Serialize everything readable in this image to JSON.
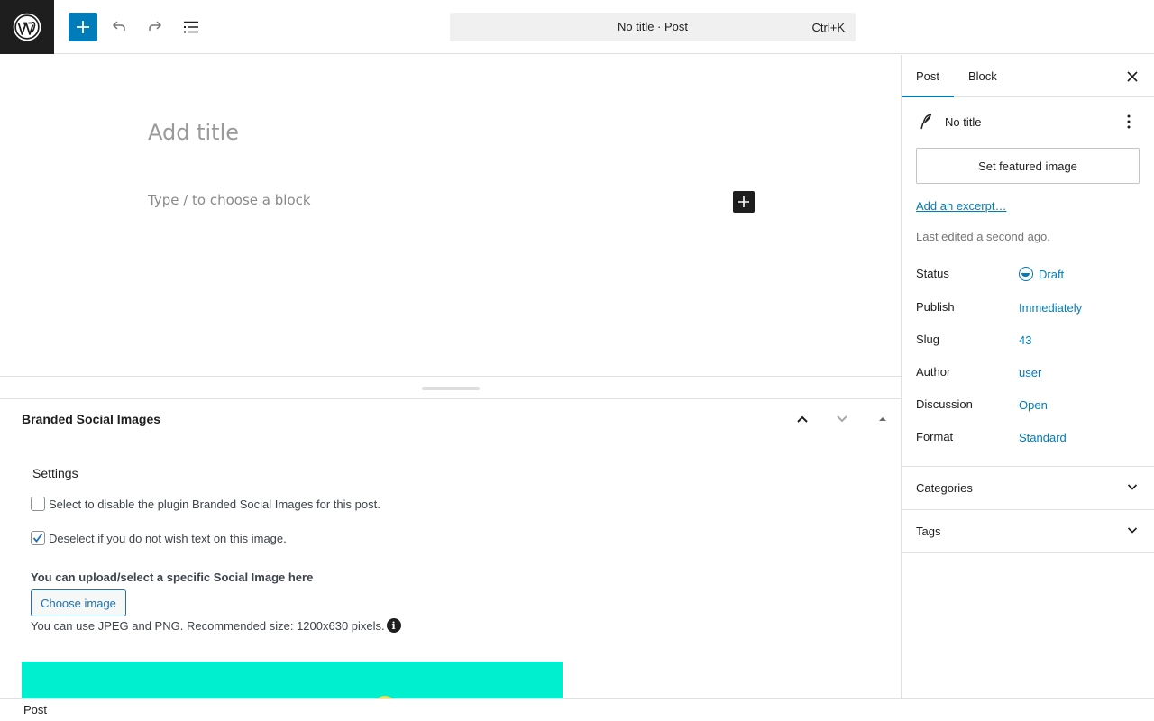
{
  "topbar": {
    "command_title": "No title · Post",
    "command_shortcut": "Ctrl+K",
    "icons": [
      "wordpress-icon",
      "plus-icon",
      "undo-icon",
      "redo-icon",
      "list-view-icon"
    ]
  },
  "canvas": {
    "title_placeholder": "Add title",
    "block_placeholder": "Type / to choose a block"
  },
  "metabox": {
    "title": "Branded Social Images",
    "settings_label": "Settings",
    "disable_label": "Select to disable the plugin Branded Social Images for this post.",
    "disable_checked": false,
    "text_label": "Deselect if you do not wish text on this image.",
    "text_checked": true,
    "upload_label": "You can upload/select a specific Social Image here",
    "choose_button": "Choose image",
    "hint": "You can use JPEG and PNG. Recommended size: 1200x630 pixels.",
    "preview_color": "#00efcf"
  },
  "sidebar": {
    "tabs": [
      {
        "label": "Post",
        "active": true
      },
      {
        "label": "Block",
        "active": false
      }
    ],
    "post_title": "No title",
    "featured_image_button": "Set featured image",
    "excerpt_link": "Add an excerpt…",
    "last_edited": "Last edited a second ago.",
    "rows": [
      {
        "label": "Status",
        "value": "Draft"
      },
      {
        "label": "Publish",
        "value": "Immediately"
      },
      {
        "label": "Slug",
        "value": "43"
      },
      {
        "label": "Author",
        "value": "user"
      },
      {
        "label": "Discussion",
        "value": "Open"
      },
      {
        "label": "Format",
        "value": "Standard"
      }
    ],
    "panels": [
      {
        "label": "Categories"
      },
      {
        "label": "Tags"
      }
    ]
  },
  "footer": {
    "breadcrumb": "Post"
  },
  "colors": {
    "accent": "#007cba",
    "dark": "#1e1e1e"
  }
}
